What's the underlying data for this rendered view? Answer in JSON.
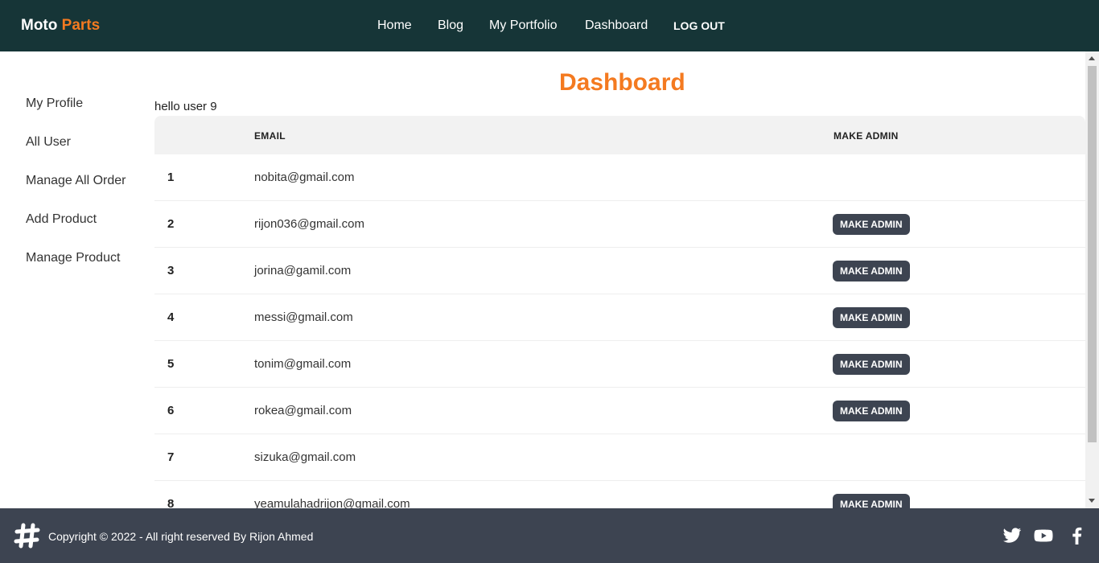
{
  "brand": {
    "name": "Moto",
    "accent": "Parts"
  },
  "nav": {
    "home": "Home",
    "blog": "Blog",
    "portfolio": "My Portfolio",
    "dashboard": "Dashboard",
    "logout": "LOG OUT"
  },
  "sidebar": {
    "items": [
      {
        "label": "My Profile"
      },
      {
        "label": "All User"
      },
      {
        "label": "Manage All Order"
      },
      {
        "label": "Add Product"
      },
      {
        "label": "Manage Product"
      }
    ]
  },
  "main": {
    "title": "Dashboard",
    "greeting": "hello user 9",
    "table": {
      "headers": {
        "num": "",
        "email": "EMAIL",
        "action": "MAKE ADMIN"
      },
      "button_label": "MAKE ADMIN",
      "rows": [
        {
          "num": "1",
          "email": "nobita@gmail.com",
          "show_button": false
        },
        {
          "num": "2",
          "email": "rijon036@gmail.com",
          "show_button": true
        },
        {
          "num": "3",
          "email": "jorina@gamil.com",
          "show_button": true
        },
        {
          "num": "4",
          "email": "messi@gmail.com",
          "show_button": true
        },
        {
          "num": "5",
          "email": "tonim@gmail.com",
          "show_button": true
        },
        {
          "num": "6",
          "email": "rokea@gmail.com",
          "show_button": true
        },
        {
          "num": "7",
          "email": "sizuka@gmail.com",
          "show_button": false
        },
        {
          "num": "8",
          "email": "yeamulahadrijon@gmail.com",
          "show_button": true
        }
      ]
    }
  },
  "footer": {
    "copyright": "Copyright © 2022 - All right reserved By Rijon Ahmed",
    "icons": [
      "hashtag-logo-icon",
      "twitter-icon",
      "youtube-icon",
      "facebook-icon"
    ]
  },
  "colors": {
    "navbar": "#163537",
    "accent": "#f47a20",
    "button": "#3d4451",
    "footer": "#3d4451",
    "table_header": "#f2f2f2"
  }
}
